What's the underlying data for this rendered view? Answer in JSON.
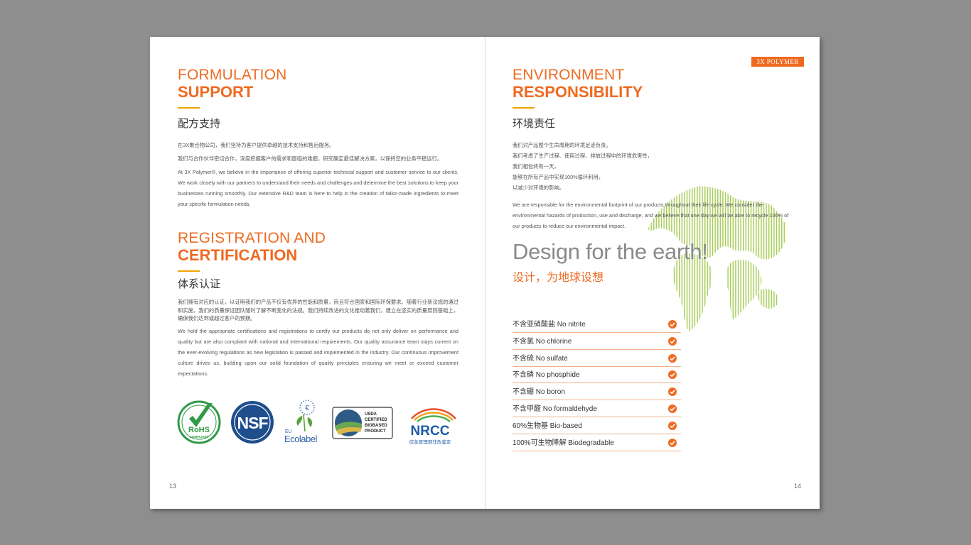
{
  "brand": {
    "tag": "3X POLYMER"
  },
  "left_page": {
    "formulation": {
      "title_light": "FORMULATION",
      "title_bold": "SUPPORT",
      "title_cn": "配方支持",
      "cn_line1": "在3X聚合物公司，我们坚持为客户提供卓越的技术支持和售后服务。",
      "cn_line2": "我们与合作伙伴密切合作，深度挖掘客户的需求和面临的难题，研究确定最佳解决方案，以保持您的业务平稳运行。",
      "en_text": "At 3X Polymer®, we believe in the importance of offering superior technical support and customer service to our clients. We work closely with our partners to understand their needs and challenges and determine the best solutions to keep your businesses running smoothly. Our extensive R&D team is here to help in the creation of tailor-made ingredients to meet your specific formulation needs."
    },
    "registration": {
      "title_light": "REGISTRATION AND",
      "title_bold": "CERTIFICATION",
      "title_cn": "体系认证",
      "cn_text": "我们拥有对应的认证，以证明我们的产品不仅有优异的性能和质量，而且符合国家和国际环保要求。随着行业新法规的通过和实施，我们的质量保证团队随时了解不断变化的法规。我们持续改进的文化推动着我们，建立在坚实的质量原则基础上，确保我们达到或超过客户的预期。",
      "en_text": "We hold the appropriate certifications and registrations to certify our products do not only deliver on performance and quality but are also compliant with national and international requirements. Our quality assurance team stays current on the ever-evolving regulations as new legislation is passed and implemented in the industry. Our continuous improvement culture drives us, building upon our solid foundation of quality principles ensuring we meet or exceed customer expectations."
    },
    "logos": {
      "rohs_top": "RoHS",
      "rohs_bottom": "COMPLIANT",
      "nsf": "NSF",
      "eu_small": "EU",
      "eu_name": "Ecolabel",
      "usda_1": "USDA",
      "usda_2": "CERTIFIED",
      "usda_3": "BIOBASED",
      "usda_4": "PRODUCT",
      "nrcc": "NRCC",
      "nrcc_cn": "应急管理部非危鉴定"
    },
    "page_number": "13"
  },
  "right_page": {
    "title_light": "ENVIRONMENT",
    "title_bold": "RESPONSIBILITY",
    "title_cn": "环境责任",
    "cn_lines": [
      "我们对产品整个生命周期的环境足迹负责。",
      "我们考虑了生产过程、使用过程、排放过程中的环境危害性，",
      "我们相信终有一天，",
      "能够在所有产品中实现100%循环利用，",
      "以减少对环境的影响。"
    ],
    "en_text": "We are responsible for the environmental footprint of our products throughout their life cycle. We consider the environmental hazards of production, use and discharge, and we believe that one day we will be able to recycle 100% of our products to reduce our environmental impact.",
    "slogan_en": "Design for the earth!",
    "slogan_cn": "设计，为地球设想",
    "checklist": [
      "不含亚硝酸盐  No nitrite",
      "不含氯  No chlorine",
      "不含硫  No sulfate",
      "不含磷  No phosphide",
      "不含硼  No boron",
      "不含甲醛  No formaldehyde",
      "60%生物基  Bio-based",
      "100%可生物降解  Biodegradable"
    ],
    "page_number": "14"
  },
  "colors": {
    "accent": "#ef6a21",
    "rule": "#f3a300",
    "globe": "#a8cd5a",
    "background": "#8e8e8e"
  }
}
